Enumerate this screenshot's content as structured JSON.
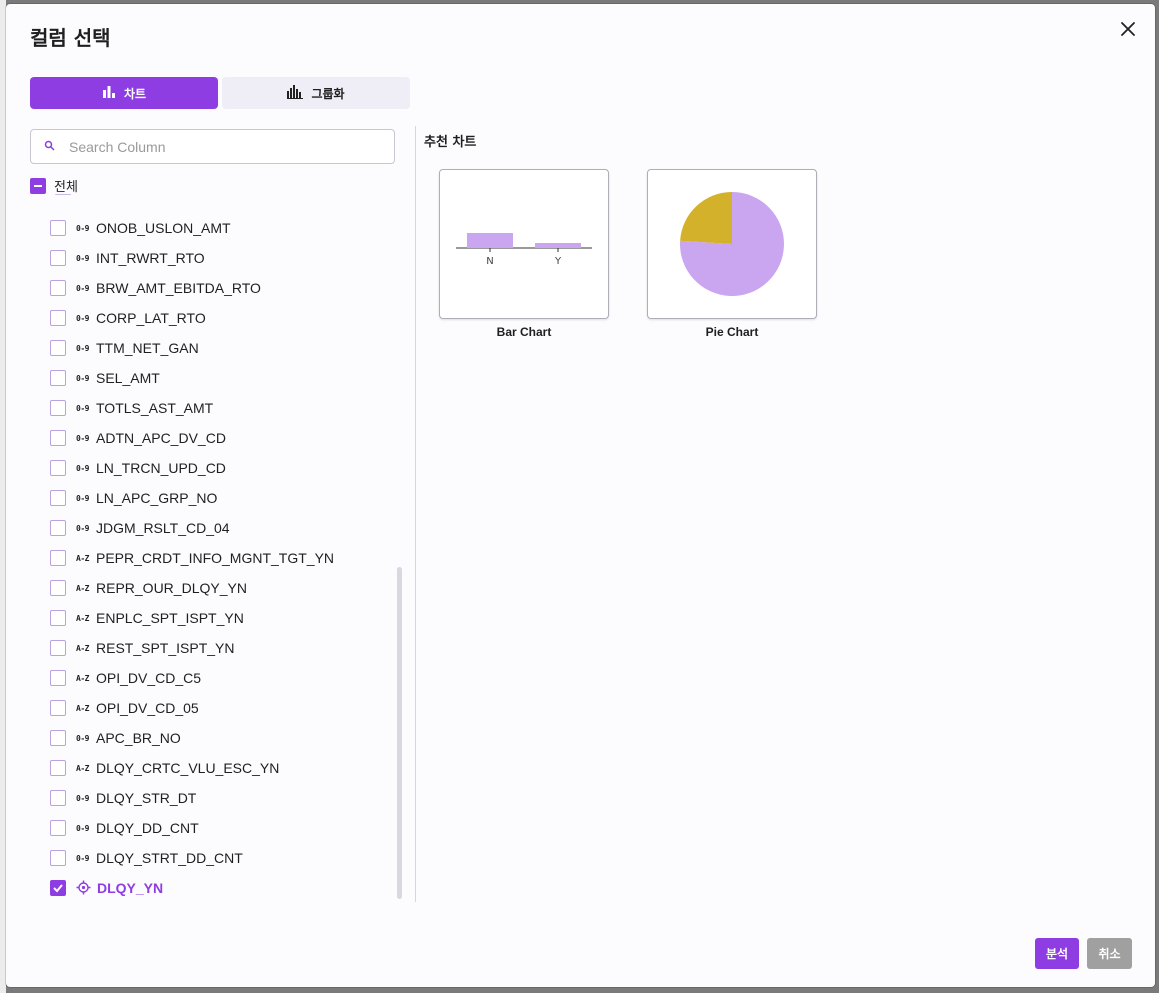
{
  "dialog": {
    "title": "컬럼 선택",
    "tabs": [
      {
        "label": "차트",
        "icon": "bar-chart-icon",
        "active": true
      },
      {
        "label": "그룹화",
        "icon": "group-bars-icon",
        "active": false
      }
    ]
  },
  "search": {
    "placeholder": "Search Column",
    "value": ""
  },
  "select_all": {
    "label": "전체",
    "state": "indeterminate"
  },
  "columns": [
    {
      "name": "ONOB_USLON_AMT",
      "type": "0-9",
      "checked": false
    },
    {
      "name": "INT_RWRT_RTO",
      "type": "0-9",
      "checked": false
    },
    {
      "name": "BRW_AMT_EBITDA_RTO",
      "type": "0-9",
      "checked": false
    },
    {
      "name": "CORP_LAT_RTO",
      "type": "0-9",
      "checked": false
    },
    {
      "name": "TTM_NET_GAN",
      "type": "0-9",
      "checked": false
    },
    {
      "name": "SEL_AMT",
      "type": "0-9",
      "checked": false
    },
    {
      "name": "TOTLS_AST_AMT",
      "type": "0-9",
      "checked": false
    },
    {
      "name": "ADTN_APC_DV_CD",
      "type": "0-9",
      "checked": false
    },
    {
      "name": "LN_TRCN_UPD_CD",
      "type": "0-9",
      "checked": false
    },
    {
      "name": "LN_APC_GRP_NO",
      "type": "0-9",
      "checked": false
    },
    {
      "name": "JDGM_RSLT_CD_04",
      "type": "0-9",
      "checked": false
    },
    {
      "name": "PEPR_CRDT_INFO_MGNT_TGT_YN",
      "type": "A-Z",
      "checked": false
    },
    {
      "name": "REPR_OUR_DLQY_YN",
      "type": "A-Z",
      "checked": false
    },
    {
      "name": "ENPLC_SPT_ISPT_YN",
      "type": "A-Z",
      "checked": false
    },
    {
      "name": "REST_SPT_ISPT_YN",
      "type": "A-Z",
      "checked": false
    },
    {
      "name": "OPI_DV_CD_C5",
      "type": "A-Z",
      "checked": false
    },
    {
      "name": "OPI_DV_CD_05",
      "type": "A-Z",
      "checked": false
    },
    {
      "name": "APC_BR_NO",
      "type": "0-9",
      "checked": false
    },
    {
      "name": "DLQY_CRTC_VLU_ESC_YN",
      "type": "A-Z",
      "checked": false
    },
    {
      "name": "DLQY_STR_DT",
      "type": "0-9",
      "checked": false
    },
    {
      "name": "DLQY_DD_CNT",
      "type": "0-9",
      "checked": false
    },
    {
      "name": "DLQY_STRT_DD_CNT",
      "type": "0-9",
      "checked": false
    },
    {
      "name": "DLQY_YN",
      "type": "target",
      "checked": true
    }
  ],
  "recommend": {
    "title": "추천 차트",
    "charts": [
      {
        "label": "Bar Chart",
        "kind": "bar"
      },
      {
        "label": "Pie Chart",
        "kind": "pie"
      }
    ]
  },
  "chart_data": [
    {
      "type": "bar",
      "categories": [
        "N",
        "Y"
      ],
      "values": [
        0.75,
        0.25
      ],
      "color": "#cba6f0"
    },
    {
      "type": "pie",
      "slices": [
        {
          "value": 0.76,
          "color": "#cba6f0"
        },
        {
          "value": 0.24,
          "color": "#d4b12a"
        }
      ]
    }
  ],
  "footer": {
    "primary_label": "분석",
    "secondary_label": "취소"
  },
  "colors": {
    "accent": "#8e3de2",
    "muted": "#a0a0a0",
    "bar": "#cba6f0",
    "pie_second": "#d4b12a"
  }
}
